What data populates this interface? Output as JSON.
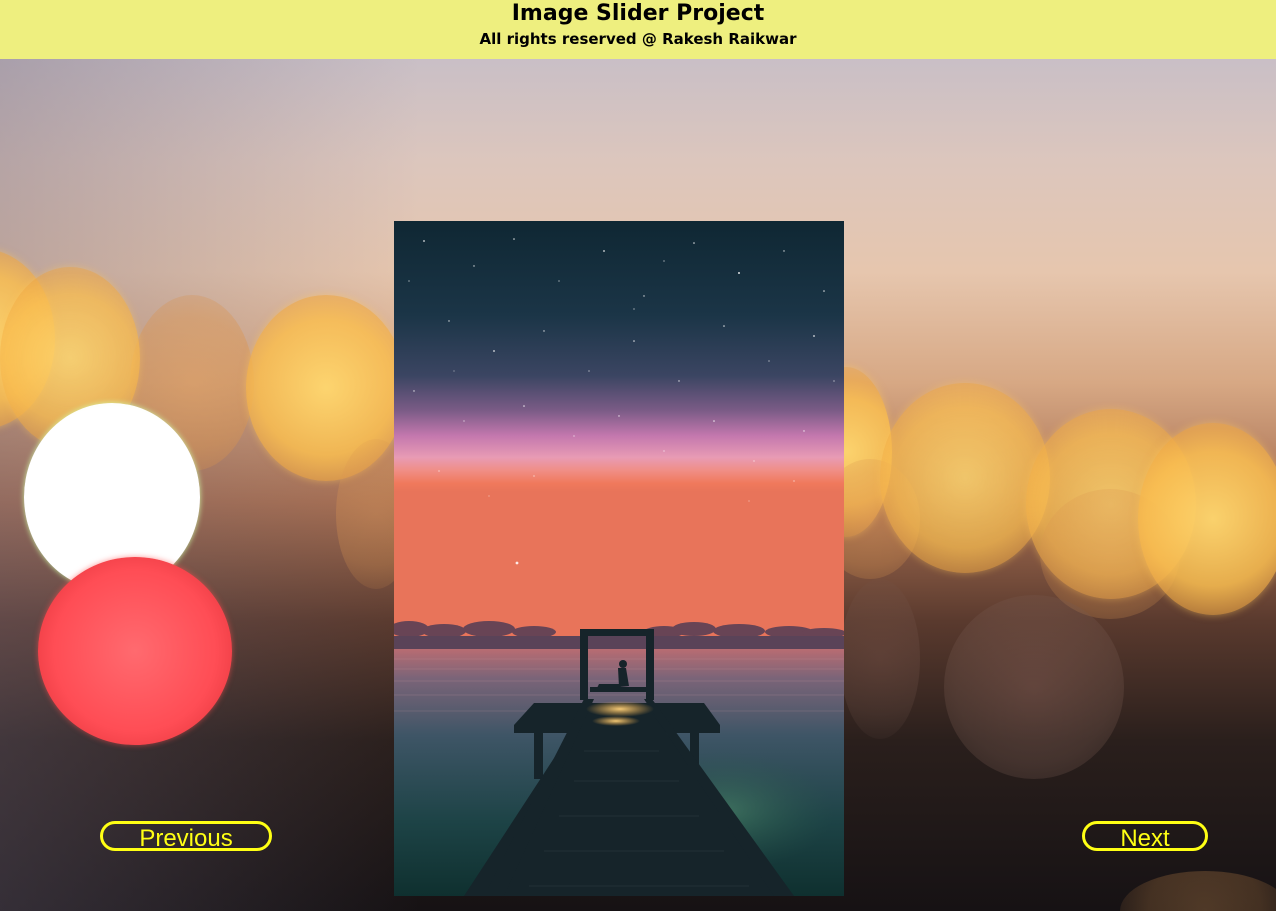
{
  "header": {
    "title": "Image Slider Project",
    "subtitle": "All rights reserved @ Rakesh Raikwar"
  },
  "slider": {
    "previous_label": "Previous",
    "next_label": "Next",
    "accent_color": "#ffff14",
    "header_color": "#eeef7f"
  },
  "slide": {
    "subject": "night sky over pier with silhouette at sunset"
  }
}
